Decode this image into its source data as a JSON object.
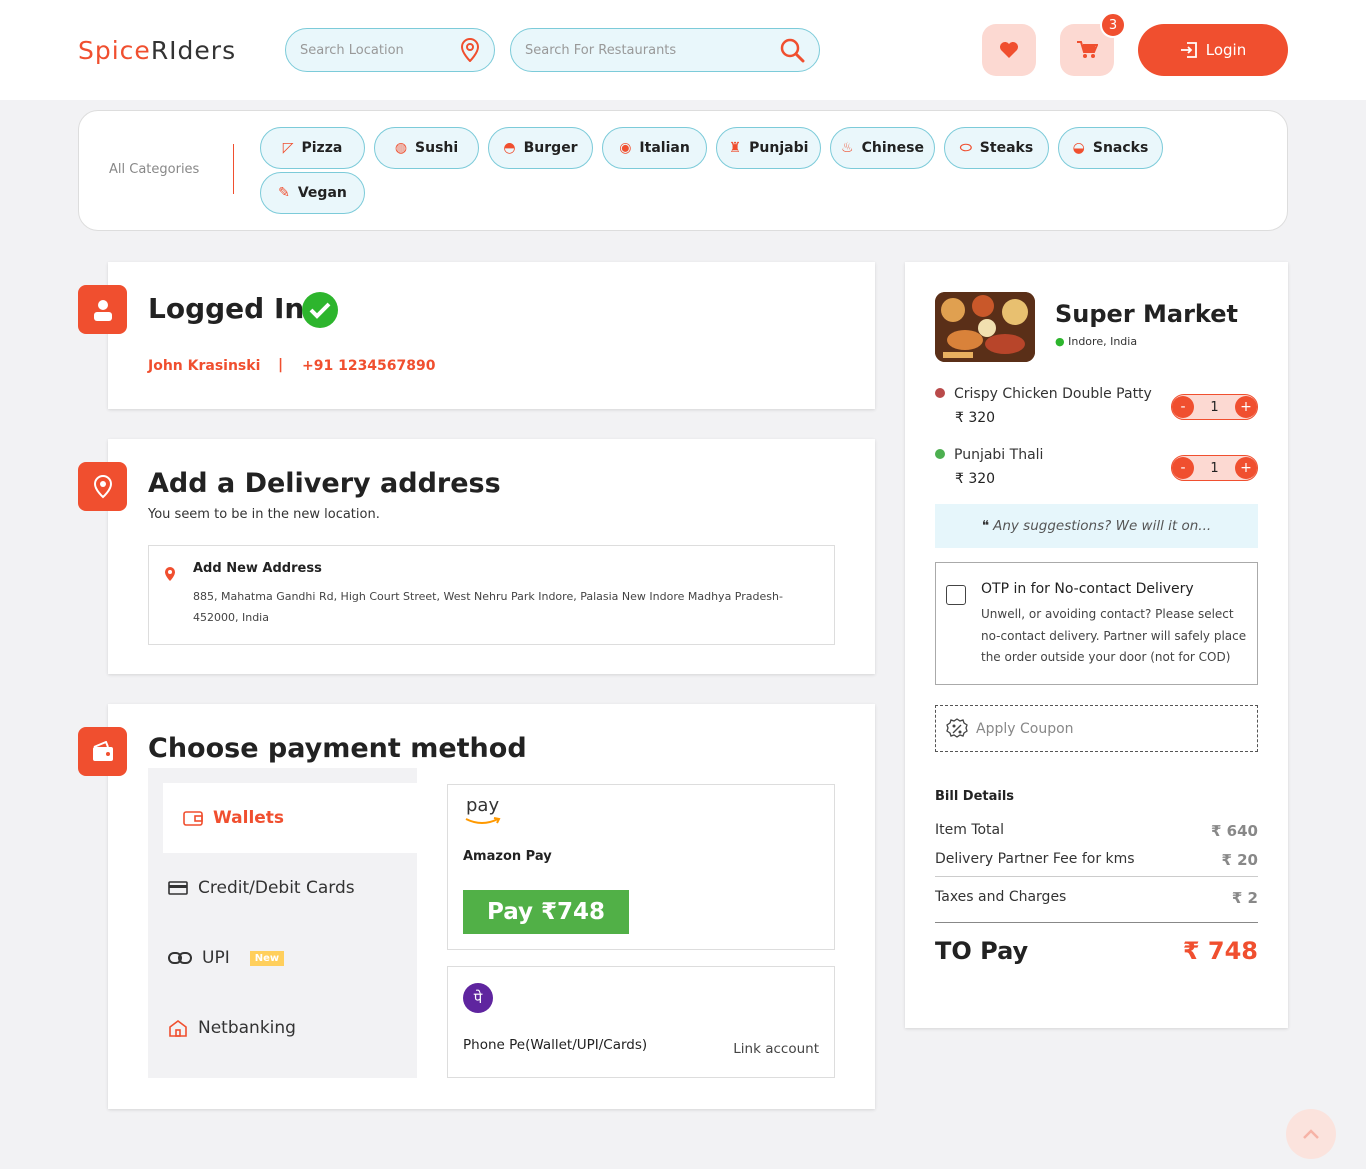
{
  "header": {
    "logo_a": "Spice",
    "logo_b": "RIders",
    "location_placeholder": "Search Location",
    "restaurant_placeholder": "Search For Restaurants",
    "cart_count": "3",
    "login_label": "Login"
  },
  "categories": {
    "label": "All Categories",
    "items": [
      "Pizza",
      "Sushi",
      "Burger",
      "Italian",
      "Punjabi",
      "Chinese",
      "Steaks",
      "Snacks",
      "Vegan"
    ]
  },
  "login_section": {
    "title": "Logged In",
    "name": "John Krasinski",
    "separator": "|",
    "phone": "+91 1234567890"
  },
  "address_section": {
    "title": "Add a Delivery address",
    "subtitle": "You seem to be in the new location.",
    "box_title": "Add New Address",
    "box_text": "885, Mahatma Gandhi Rd, High Court Street, West Nehru Park Indore, Palasia New Indore Madhya Pradesh- 452000, India"
  },
  "payment_section": {
    "title": "Choose payment method",
    "tabs": [
      "Wallets",
      "Credit/Debit Cards",
      "UPI",
      "Netbanking"
    ],
    "new_badge": "New",
    "amazon_logo": "pay",
    "amazon_label": "Amazon Pay",
    "pay_button": "Pay ₹748",
    "phonepe_logo": "पे",
    "phonepe_label": "Phone Pe(Wallet/UPI/Cards)",
    "link_account": "Link account"
  },
  "cart": {
    "store_name": "Super Market",
    "store_location": "Indore, India",
    "items": [
      {
        "name": "Crispy Chicken Double Patty",
        "price": "₹ 320",
        "qty": "1",
        "dot_color": "#b94a4a"
      },
      {
        "name": "Punjabi Thali",
        "price": "₹ 320",
        "qty": "1",
        "dot_color": "#4caf50"
      }
    ],
    "minus": "-",
    "plus": "+",
    "suggestions": "Any suggestions? We will it on...",
    "otp_title": "OTP in for No-contact Delivery",
    "otp_text": "Unwell, or avoiding contact? Please select no-contact delivery. Partner will safely place the order outside your door (not for COD)",
    "coupon": "Apply Coupon",
    "bill_title": "Bill Details",
    "bill": [
      {
        "label": "Item Total",
        "value": "₹ 640"
      },
      {
        "label": "Delivery Partner Fee for kms",
        "value": "₹ 20"
      },
      {
        "label": "Taxes and Charges",
        "value": "₹ 2"
      }
    ],
    "to_pay_label": "TO Pay",
    "to_pay_value": "₹ 748"
  },
  "colors": {
    "accent": "#f04f2f",
    "chip_bg": "#eaf7fb",
    "pay_green": "#51b047"
  }
}
